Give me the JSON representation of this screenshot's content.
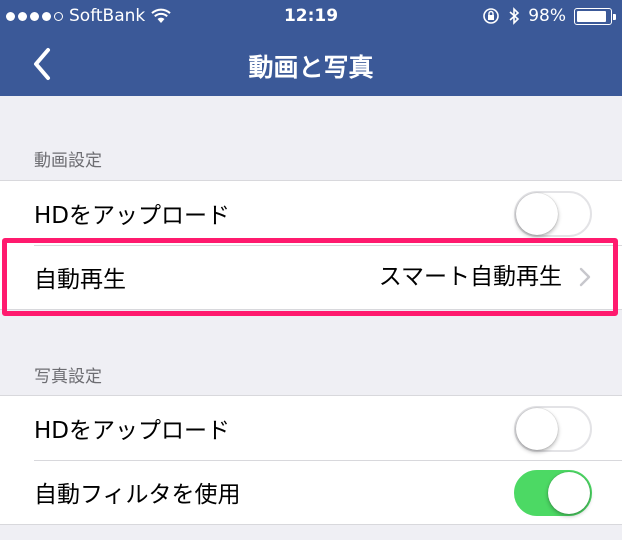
{
  "status_bar": {
    "carrier": "SoftBank",
    "time": "12:19",
    "battery": "98%",
    "battery_level": 0.98
  },
  "navbar": {
    "title": "動画と写真",
    "back_icon": "chevron-left-icon"
  },
  "video_section": {
    "header": "動画設定",
    "rows": [
      {
        "label": "HDをアップロード",
        "toggle": false
      },
      {
        "label": "自動再生",
        "value": "スマート自動再生"
      }
    ]
  },
  "photo_section": {
    "header": "写真設定",
    "rows": [
      {
        "label": "HDをアップロード",
        "toggle": false
      },
      {
        "label": "自動フィルタを使用",
        "toggle": true
      }
    ]
  },
  "colors": {
    "navbar": "#3b5998",
    "toggle_on": "#4cd964",
    "highlight": "#ff1a6e",
    "background": "#efeff4"
  }
}
